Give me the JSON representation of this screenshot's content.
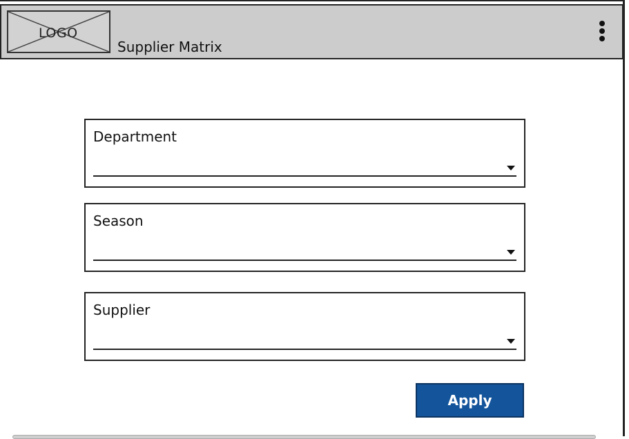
{
  "header": {
    "logo_text": "LOGO",
    "title": "Supplier Matrix",
    "menu_icon": "kebab-menu-icon"
  },
  "form": {
    "fields": [
      {
        "label": "Department",
        "value": "",
        "icon": "chevron-down-icon"
      },
      {
        "label": "Season",
        "value": "",
        "icon": "chevron-down-icon"
      },
      {
        "label": "Supplier",
        "value": "",
        "icon": "chevron-down-icon"
      }
    ],
    "apply_label": "Apply"
  },
  "colors": {
    "header_bg": "#cccccc",
    "primary_button": "#13549b"
  }
}
